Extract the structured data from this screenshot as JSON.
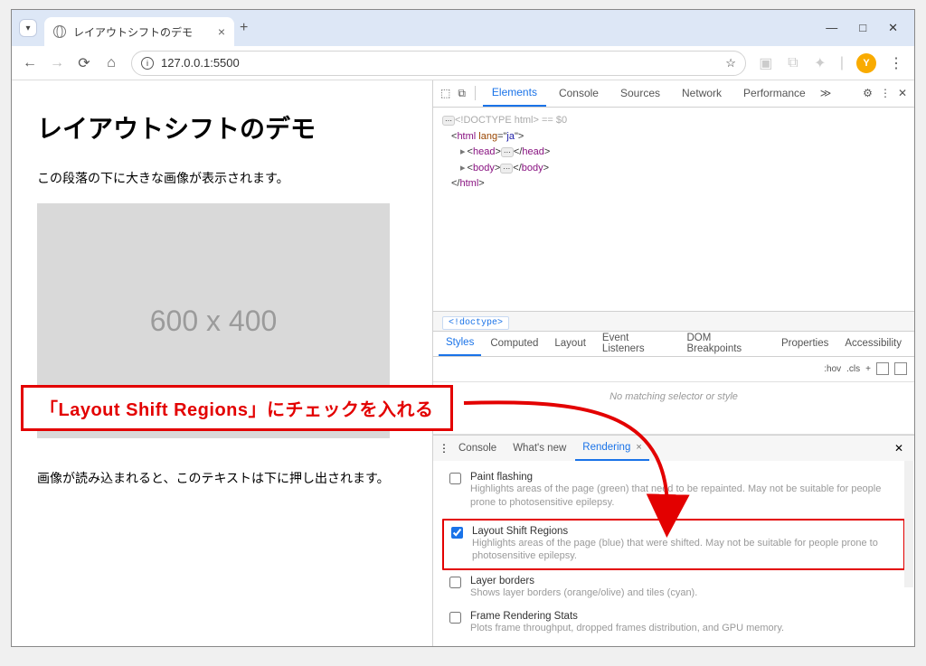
{
  "browser": {
    "tab_title": "レイアウトシフトのデモ",
    "new_tab": "+",
    "win": {
      "min": "—",
      "max": "□",
      "close": "✕"
    },
    "nav": {
      "back": "←",
      "fwd": "→",
      "reload": "⟳",
      "home": "⌂"
    },
    "url_info_glyph": "i",
    "url": "127.0.0.1:5500",
    "star": "☆",
    "ext1": "▣",
    "ext2": "⧉",
    "puzzle": "✦",
    "avatar_initial": "Y",
    "menu": "⋮"
  },
  "page": {
    "h1": "レイアウトシフトのデモ",
    "p1": "この段落の下に大きな画像が表示されます。",
    "placeholder": "600 x 400",
    "p2": "画像が読み込まれると、このテキストは下に押し出されます。"
  },
  "devtools": {
    "top_tabs": [
      "Elements",
      "Console",
      "Sources",
      "Network",
      "Performance"
    ],
    "more": "≫",
    "gear": "⚙",
    "menu": "⋮",
    "close": "✕",
    "inspect": "⬚",
    "device": "⧉",
    "code": {
      "doctype": "<!DOCTYPE html>",
      "eq": " == $0",
      "html_open": "<html lang=\"ja\">",
      "head": "<head>…</head>",
      "body": "<body>…</body>",
      "html_close": "</html>",
      "ellipsis": "⋯"
    },
    "crumb": "<!doctype>",
    "style_tabs": [
      "Styles",
      "Computed",
      "Layout",
      "Event Listeners",
      "DOM Breakpoints",
      "Properties",
      "Accessibility"
    ],
    "filter": {
      "hov": ":hov",
      "cls": ".cls",
      "plus": "+"
    },
    "nosel": "No matching selector or style",
    "drawer_tabs": {
      "menu": "⋮",
      "console": "Console",
      "whatsnew": "What's new",
      "rendering": "Rendering",
      "close": "✕"
    },
    "render": {
      "paint": {
        "t": "Paint flashing",
        "d": "Highlights areas of the page (green) that need to be repainted. May not be suitable for people prone to photosensitive epilepsy."
      },
      "lsr": {
        "t": "Layout Shift Regions",
        "d": "Highlights areas of the page (blue) that were shifted. May not be suitable for people prone to photosensitive epilepsy."
      },
      "layer": {
        "t": "Layer borders",
        "d": "Shows layer borders (orange/olive) and tiles (cyan)."
      },
      "frame": {
        "t": "Frame Rendering Stats",
        "d": "Plots frame throughput, dropped frames distribution, and GPU memory."
      }
    }
  },
  "callout": "「Layout Shift Regions」にチェックを入れる"
}
